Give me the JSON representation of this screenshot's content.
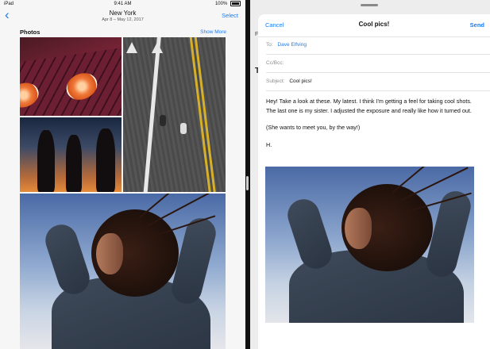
{
  "status_bar": {
    "device": "iPad",
    "time": "9:41 AM",
    "battery": "100%"
  },
  "photos": {
    "back_icon": "chevron-left-icon",
    "location": "New York",
    "date_range": "Apr 8 – May 12, 2017",
    "select_label": "Select",
    "section_title": "Photos",
    "show_more_label": "Show More",
    "tiles": [
      "oranges",
      "road",
      "silhouettes",
      "hair"
    ]
  },
  "mail": {
    "behind_labels": {
      "f": "F",
      "r": "T"
    },
    "cancel_label": "Cancel",
    "title": "Cool pics!",
    "send_label": "Send",
    "to_label": "To:",
    "to_value": "Dave Elfving",
    "cc_label": "Cc/Bcc:",
    "subject_label": "Subject:",
    "subject_value": "Cool pics!",
    "body_para1": "Hey! Take a look at these. My latest. I think I'm getting a feel for taking cool shots. The last one is my sister. I adjusted the exposure and really like how it turned out.",
    "body_para2": "(She wants to meet you, by the way!)",
    "signature": "H."
  },
  "colors": {
    "accent": "#1a7cf5",
    "divider": "#111111"
  }
}
